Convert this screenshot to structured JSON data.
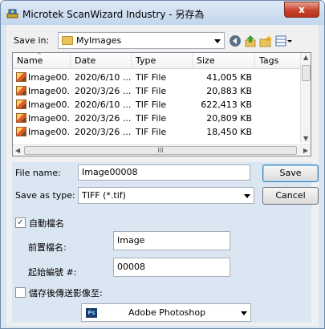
{
  "window": {
    "title": "Microtek ScanWizard Industry - 另存為",
    "close_label": "x"
  },
  "save_in": {
    "label": "Save in:",
    "folder": "MyImages"
  },
  "toolbar": {
    "back_icon": "back-icon",
    "up_icon": "up-folder-icon",
    "new_folder_icon": "new-folder-icon",
    "views_icon": "views-menu-icon"
  },
  "file_list": {
    "columns": [
      "Name",
      "Date",
      "Type",
      "Size",
      "Tags"
    ],
    "rows": [
      {
        "name": "Image00...",
        "date": "2020/6/10 ...",
        "type": "TIF File",
        "size": "41,005 KB"
      },
      {
        "name": "Image00...",
        "date": "2020/3/26 ...",
        "type": "TIF File",
        "size": "20,883 KB"
      },
      {
        "name": "Image00...",
        "date": "2020/6/10 ...",
        "type": "TIF File",
        "size": "622,413 KB"
      },
      {
        "name": "Image00...",
        "date": "2020/3/26 ...",
        "type": "TIF File",
        "size": "20,809 KB"
      },
      {
        "name": "Image00...",
        "date": "2020/3/26 ...",
        "type": "TIF File",
        "size": "18,450 KB"
      }
    ],
    "hscroll_grip": "III"
  },
  "file_name": {
    "label": "File name:",
    "value": "Image00008"
  },
  "save_type": {
    "label": "Save as type:",
    "value": "TIFF (*.tif)"
  },
  "buttons": {
    "save": "Save",
    "cancel": "Cancel"
  },
  "auto_naming": {
    "label": "自動檔名",
    "checked": true,
    "check_mark": "✓",
    "prefix_label": "前置檔名:",
    "prefix_value": "Image",
    "start_label": "起始編號 #:",
    "start_value": "00008"
  },
  "send_after_save": {
    "label": "儲存後傳送影像至:",
    "checked": false,
    "app_icon_text": "Ps",
    "app": "Adobe Photoshop"
  }
}
